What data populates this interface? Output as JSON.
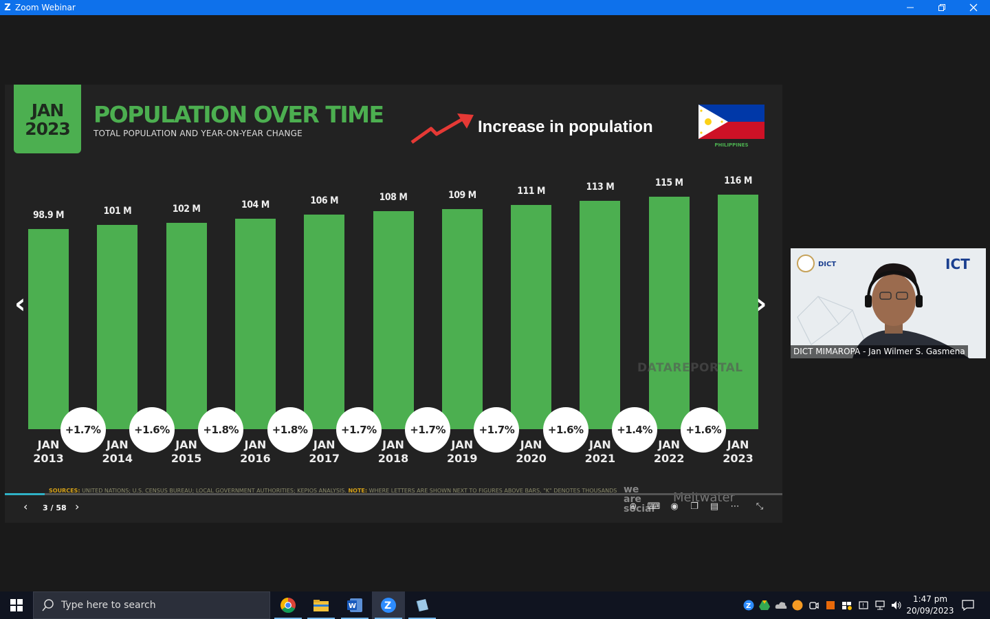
{
  "window": {
    "title": "Zoom Webinar"
  },
  "slide": {
    "date_line1": "JAN",
    "date_line2": "2023",
    "title": "POPULATION OVER TIME",
    "subtitle": "TOTAL POPULATION AND YEAR-ON-YEAR CHANGE",
    "annotation": "Increase in population",
    "flag_label": "PHILIPPINES",
    "watermark": "DATAREPORTAL",
    "sources_label": "SOURCES:",
    "sources_text": "UNITED NATIONS; U.S. CENSUS BUREAU; LOCAL GOVERNMENT AUTHORITIES; KEPIOS ANALYSIS.",
    "note_label": "NOTE:",
    "note_text": "WHERE LETTERS ARE SHOWN NEXT TO FIGURES ABOVE BARS, \"K\" DENOTES THOUSANDS",
    "brand1": "we are social",
    "brand2": "Meltwater"
  },
  "chart_data": {
    "type": "bar",
    "title": "POPULATION OVER TIME",
    "categories": [
      "JAN 2013",
      "JAN 2014",
      "JAN 2015",
      "JAN 2016",
      "JAN 2017",
      "JAN 2018",
      "JAN 2019",
      "JAN 2020",
      "JAN 2021",
      "JAN 2022",
      "JAN 2023"
    ],
    "category_lines": [
      [
        "JAN",
        "2013"
      ],
      [
        "JAN",
        "2014"
      ],
      [
        "JAN",
        "2015"
      ],
      [
        "JAN",
        "2016"
      ],
      [
        "JAN",
        "2017"
      ],
      [
        "JAN",
        "2018"
      ],
      [
        "JAN",
        "2019"
      ],
      [
        "JAN",
        "2020"
      ],
      [
        "JAN",
        "2021"
      ],
      [
        "JAN",
        "2022"
      ],
      [
        "JAN",
        "2023"
      ]
    ],
    "values": [
      98.9,
      101,
      102,
      104,
      106,
      108,
      109,
      111,
      113,
      115,
      116
    ],
    "value_labels": [
      "98.9 M",
      "101 M",
      "102 M",
      "104 M",
      "106 M",
      "108 M",
      "109 M",
      "111 M",
      "113 M",
      "115 M",
      "116 M"
    ],
    "changes": [
      "+1.7%",
      "+1.6%",
      "+1.8%",
      "+1.8%",
      "+1.7%",
      "+1.7%",
      "+1.7%",
      "+1.6%",
      "+1.4%",
      "+1.6%"
    ],
    "color": "#4caf50"
  },
  "presentation": {
    "page": "3 / 58",
    "progress": 0.0517
  },
  "video": {
    "participant": "DICT MIMAROPA - Jan Wilmer S. Gasmena",
    "logo_left": "DICT",
    "logo_right": "ICT"
  },
  "taskbar": {
    "search_placeholder": "Type here to search",
    "time": "1:47 pm",
    "date": "20/09/2023"
  }
}
